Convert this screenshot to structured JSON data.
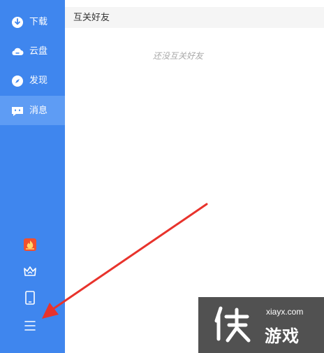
{
  "sidebar": {
    "items": [
      {
        "label": "下载",
        "icon": "download-icon"
      },
      {
        "label": "云盘",
        "icon": "cloud-icon"
      },
      {
        "label": "发现",
        "icon": "compass-icon"
      },
      {
        "label": "消息",
        "icon": "message-icon",
        "active": true
      }
    ],
    "bottom_icons": [
      "crown-fire-badge-icon",
      "crown-icon",
      "phone-icon",
      "menu-icon"
    ]
  },
  "main": {
    "header_title": "互关好友",
    "empty_hint": "还没互关好友"
  },
  "watermark": {
    "url": "xiayx.com",
    "name": "游戏"
  },
  "colors": {
    "sidebar": "#3f86ee",
    "sidebar_active": "#5e9cf4",
    "header_bg": "#f5f5f5",
    "annotation_arrow": "#e8332c"
  }
}
